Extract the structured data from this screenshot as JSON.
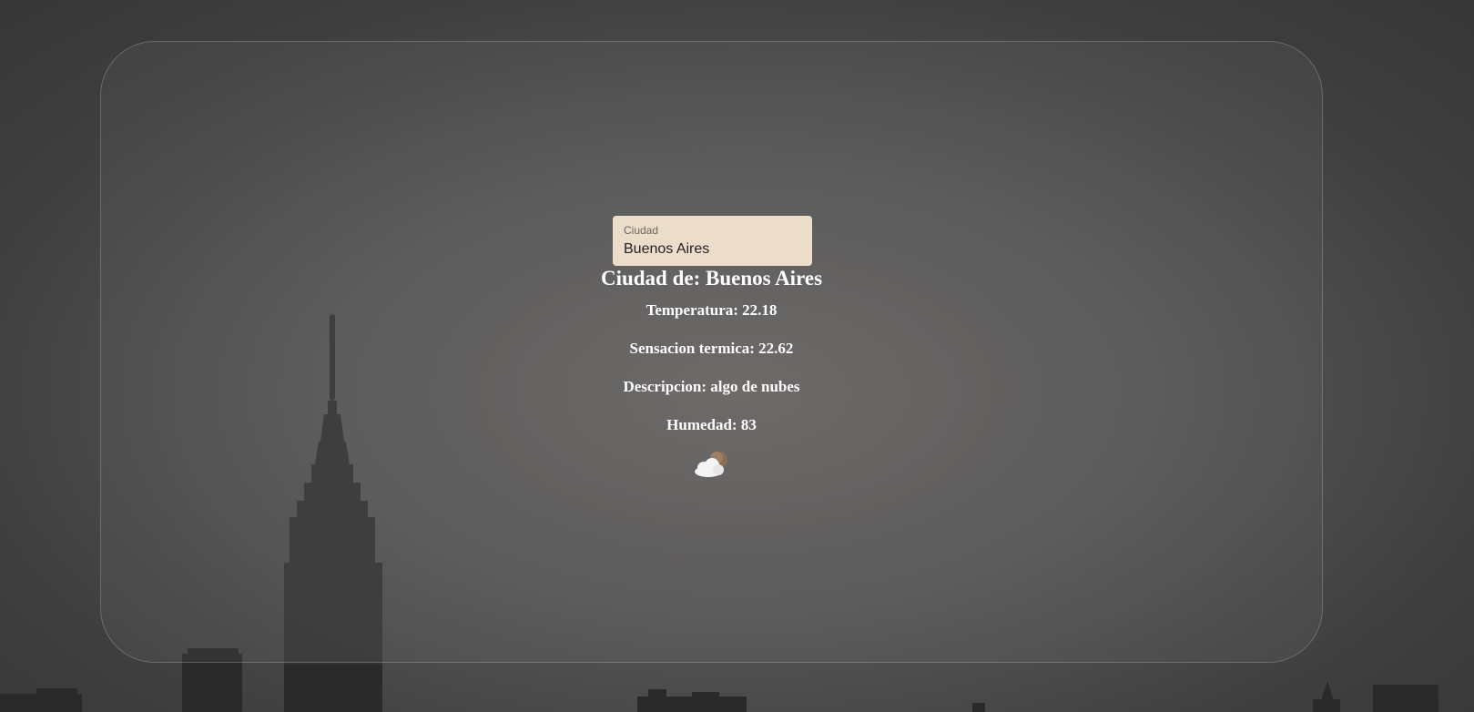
{
  "search": {
    "label": "Ciudad",
    "value": "Buenos Aires"
  },
  "weather": {
    "city_line": "Ciudad de: Buenos Aires",
    "temperature_line": "Temperatura: 22.18",
    "feels_like_line": "Sensacion termica: 22.62",
    "description_line": "Descripcion: algo de nubes",
    "humidity_line": "Humedad: 83",
    "icon": "cloud-with-moon-icon"
  },
  "colors": {
    "background": "#4a4a4b",
    "input_background": "#ecdcca",
    "text": "#ffffff",
    "skyline": "#2c2c2c"
  }
}
